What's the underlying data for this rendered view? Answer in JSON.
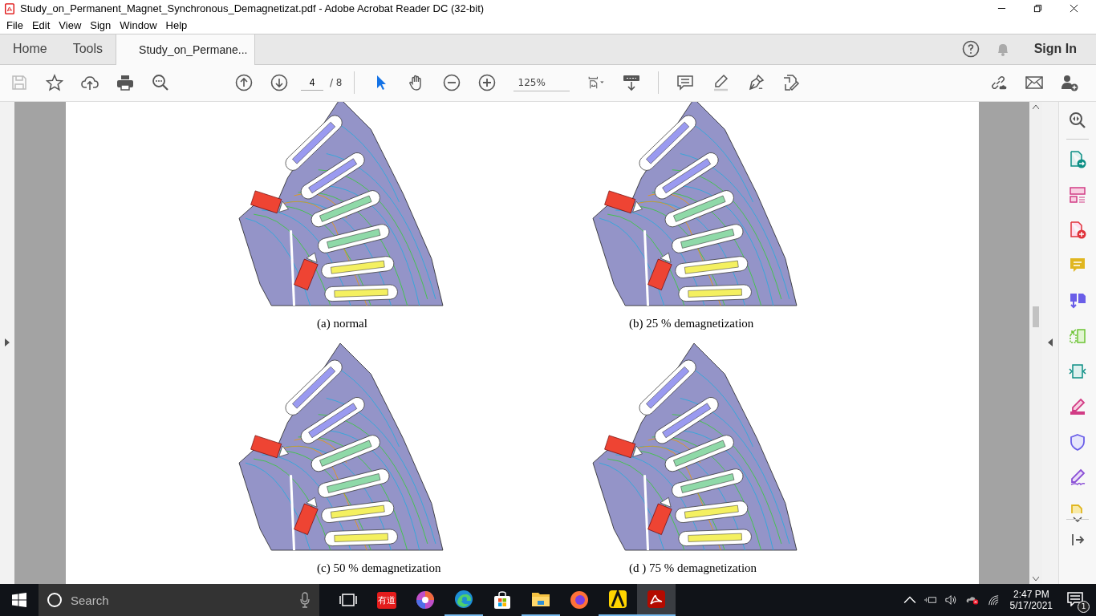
{
  "window": {
    "title": "Study_on_Permanent_Magnet_Synchronous_Demagnetizat.pdf - Adobe Acrobat Reader DC (32-bit)"
  },
  "menu": [
    "File",
    "Edit",
    "View",
    "Sign",
    "Window",
    "Help"
  ],
  "tabs": [
    {
      "label": "Home",
      "selected": false
    },
    {
      "label": "Tools",
      "selected": false
    },
    {
      "label": "Study_on_Permane...",
      "selected": true
    }
  ],
  "sign_in": "Sign In",
  "toolbar": {
    "page": "4",
    "page_total": "/ 8",
    "zoom": "125%"
  },
  "figures": [
    {
      "caption": "(a) normal"
    },
    {
      "caption": "(b) 25 % demagnetization"
    },
    {
      "caption": "(c) 50 % demagnetization"
    },
    {
      "caption": "(d ) 75 % demagnetization"
    }
  ],
  "taskbar": {
    "search": {
      "placeholder": "Search"
    },
    "youdao": "有道",
    "time": "2:47 PM",
    "date": "5/17/2021",
    "notifications": "1"
  }
}
